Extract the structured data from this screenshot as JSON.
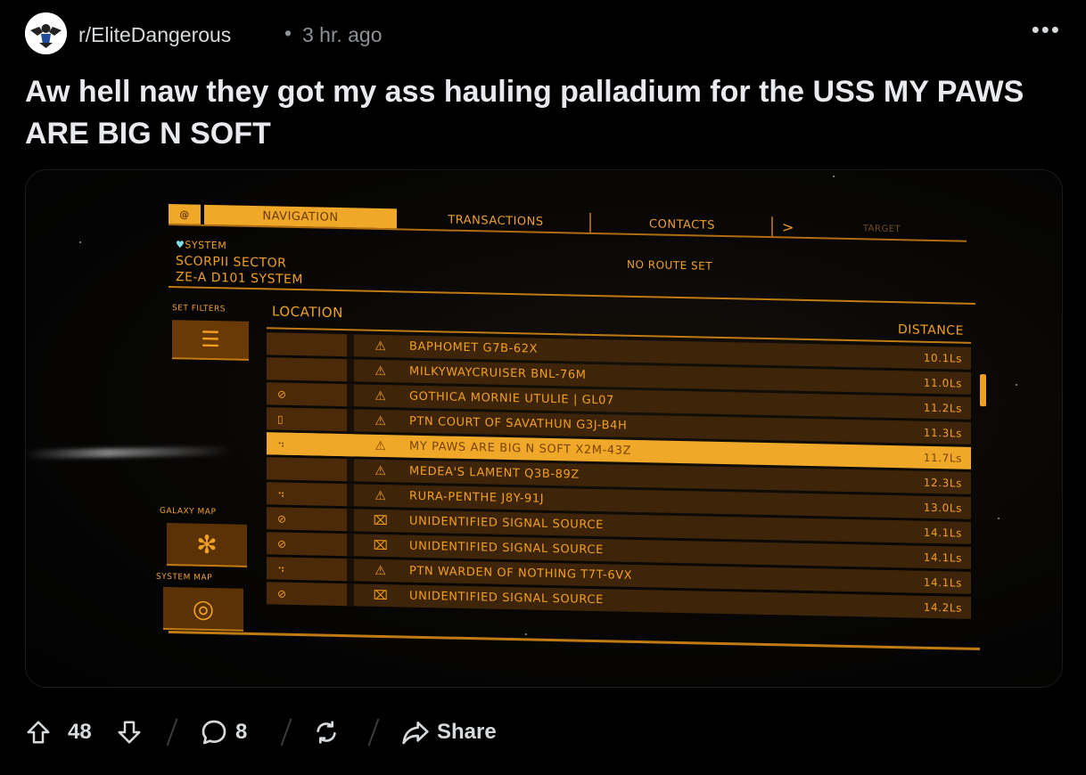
{
  "post": {
    "subreddit": "r/EliteDangerous",
    "separator": "•",
    "age": "3 hr. ago",
    "more": "•••",
    "title": "Aw hell naw they got my ass hauling palladium for the USS MY PAWS ARE BIG N SOFT"
  },
  "game": {
    "tabs": {
      "logo": "@",
      "navigation": "NAVIGATION",
      "transactions": "TRANSACTIONS",
      "contacts": "CONTACTS",
      "arrow": ">",
      "target": "TARGET"
    },
    "system": {
      "label": "SYSTEM",
      "line1": "SCORPII SECTOR",
      "line2": "ZE-A D101 SYSTEM"
    },
    "route": "NO ROUTE SET",
    "filters_label": "SET FILTERS",
    "location_header": "LOCATION",
    "distance_header": "DISTANCE",
    "galaxy_map": "GALAXY MAP",
    "system_map": "SYSTEM MAP",
    "rows": [
      {
        "name": "BAPHOMET G7B-62X",
        "distance": "10.1Ls",
        "icon": "carrier"
      },
      {
        "name": "MILKYWAYCRUISER BNL-76M",
        "distance": "11.0Ls",
        "icon": "carrier"
      },
      {
        "name": "GOTHICA MORNIE UTULIE | GL07",
        "distance": "11.2Ls",
        "icon": "carrier"
      },
      {
        "name": "PTN COURT OF SAVATHUN G3J-B4H",
        "distance": "11.3Ls",
        "icon": "carrier"
      },
      {
        "name": "MY PAWS ARE BIG N SOFT X2M-43Z",
        "distance": "11.7Ls",
        "icon": "carrier",
        "selected": true
      },
      {
        "name": "MEDEA'S LAMENT Q3B-89Z",
        "distance": "12.3Ls",
        "icon": "carrier"
      },
      {
        "name": "RURA-PENTHE J8Y-91J",
        "distance": "13.0Ls",
        "icon": "carrier"
      },
      {
        "name": "UNIDENTIFIED SIGNAL SOURCE",
        "distance": "14.1Ls",
        "icon": "signal"
      },
      {
        "name": "UNIDENTIFIED SIGNAL SOURCE",
        "distance": "14.1Ls",
        "icon": "signal"
      },
      {
        "name": "PTN WARDEN OF NOTHING T7T-6VX",
        "distance": "14.1Ls",
        "icon": "carrier"
      },
      {
        "name": "UNIDENTIFIED SIGNAL SOURCE",
        "distance": "14.2Ls",
        "icon": "signal"
      }
    ]
  },
  "actions": {
    "upvotes": "48",
    "comments": "8",
    "share": "Share"
  }
}
